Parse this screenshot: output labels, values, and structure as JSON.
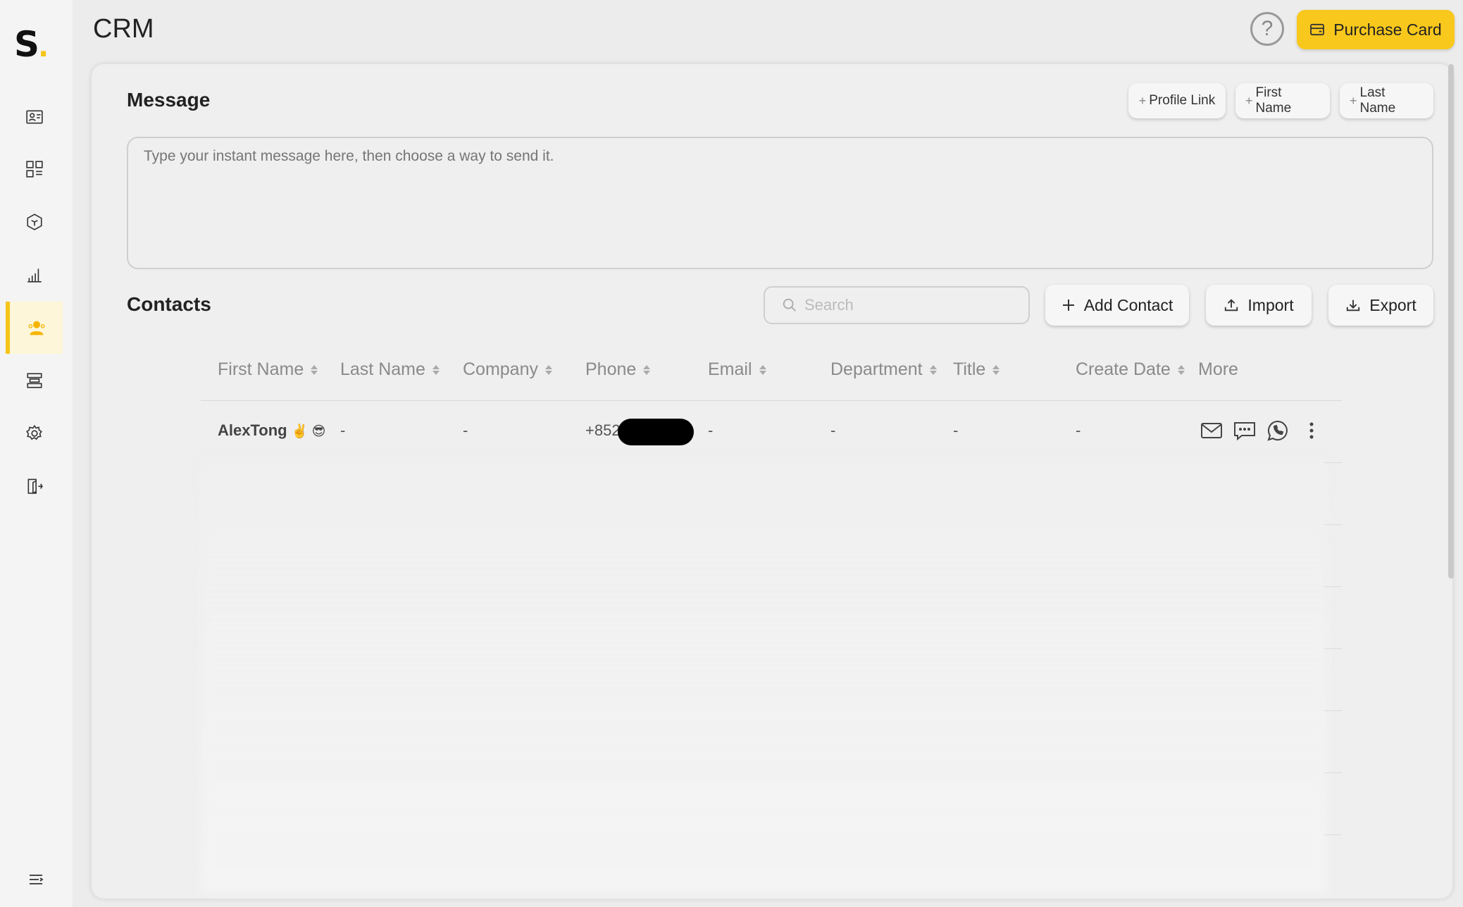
{
  "header": {
    "title": "CRM",
    "help_glyph": "?",
    "purchase_label": "Purchase Card"
  },
  "logo": {
    "letter": "S",
    "dot": "."
  },
  "sidebar": {
    "items": [
      {
        "icon": "profile-card-icon"
      },
      {
        "icon": "dashboard-grid-icon"
      },
      {
        "icon": "cube-icon"
      },
      {
        "icon": "bar-chart-icon"
      },
      {
        "icon": "contacts-icon",
        "active": true
      },
      {
        "icon": "layers-icon"
      },
      {
        "icon": "settings-icon"
      },
      {
        "icon": "logout-icon"
      }
    ],
    "collapse_icon": "menu-collapse-icon"
  },
  "message": {
    "title": "Message",
    "placeholder": "Type your instant message here, then choose a way to send it.",
    "chips": [
      {
        "plus": "+",
        "label": "Profile Link"
      },
      {
        "plus": "+",
        "label": "First Name"
      },
      {
        "plus": "+",
        "label": "Last Name"
      }
    ]
  },
  "contacts": {
    "title": "Contacts",
    "search_placeholder": "Search",
    "add_label": "Add Contact",
    "import_label": "Import",
    "export_label": "Export",
    "columns": [
      "First Name",
      "Last Name",
      "Company",
      "Phone",
      "Email",
      "Department",
      "Title",
      "Create Date",
      "More"
    ],
    "rows": [
      {
        "first_name": "AlexTong",
        "emojis": "✌️ 😎",
        "last_name": "-",
        "company": "-",
        "phone": "+852",
        "email": "-",
        "department": "-",
        "title": "-",
        "create_date": "-"
      }
    ]
  },
  "colors": {
    "accent": "#f8c81c",
    "active_bg": "#fdf6d8"
  }
}
